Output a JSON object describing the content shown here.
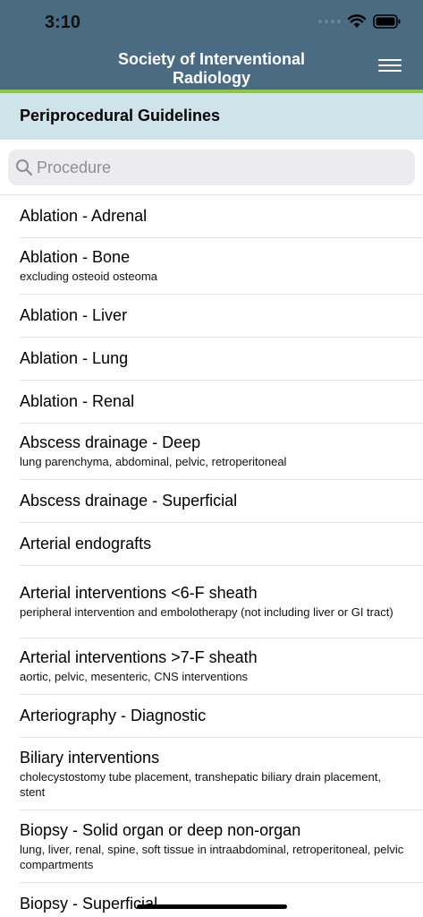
{
  "status_bar": {
    "time": "3:10"
  },
  "header": {
    "title": "Society of Interventional Radiology"
  },
  "section": {
    "title": "Periprocedural Guidelines"
  },
  "search": {
    "placeholder": "Procedure",
    "value": ""
  },
  "procedures": [
    {
      "title": "Ablation - Adrenal",
      "subtitle": ""
    },
    {
      "title": "Ablation - Bone",
      "subtitle": "excluding osteoid osteoma"
    },
    {
      "title": "Ablation - Liver",
      "subtitle": ""
    },
    {
      "title": "Ablation - Lung",
      "subtitle": ""
    },
    {
      "title": "Ablation - Renal",
      "subtitle": ""
    },
    {
      "title": "Abscess drainage - Deep",
      "subtitle": "lung parenchyma, abdominal, pelvic, retroperitoneal"
    },
    {
      "title": "Abscess drainage - Superficial",
      "subtitle": ""
    },
    {
      "title": "Arterial endografts",
      "subtitle": ""
    },
    {
      "title": "Arterial interventions <6-F sheath",
      "subtitle": "peripheral intervention and embolotherapy (not including liver or GI tract)"
    },
    {
      "title": "Arterial interventions >7-F sheath",
      "subtitle": "aortic, pelvic, mesenteric, CNS interventions"
    },
    {
      "title": "Arteriography - Diagnostic",
      "subtitle": ""
    },
    {
      "title": "Biliary interventions",
      "subtitle": "cholecystostomy tube placement, transhepatic biliary drain placement, stent"
    },
    {
      "title": "Biopsy - Solid organ or deep non-organ",
      "subtitle": "lung, liver, renal, spine, soft tissue in intraabdominal, retroperitoneal, pelvic compartments"
    },
    {
      "title": "Biopsy - Superficial",
      "subtitle": ""
    }
  ]
}
